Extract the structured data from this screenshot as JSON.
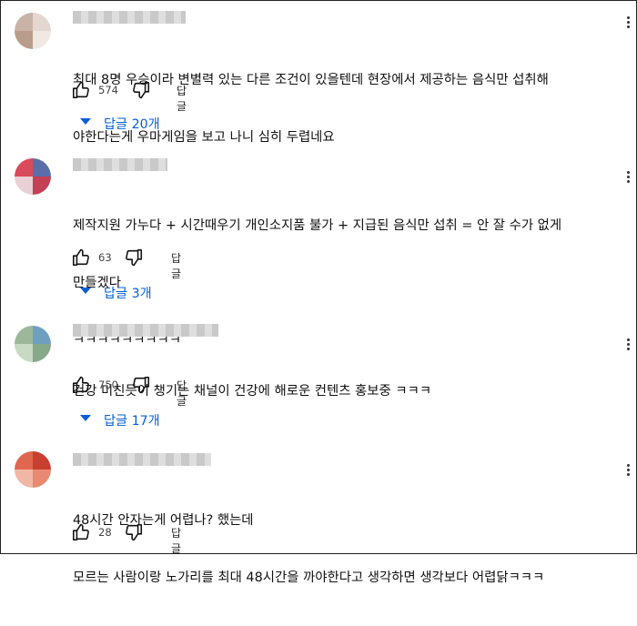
{
  "comments": [
    {
      "lines": [
        "최대 8명 우승이라 변별력 있는 다른 조건이 있을텐데 현장에서 제공하는 음식만 섭취해",
        "야한다는게 우마게임을 보고 나니 심히 두렵네요"
      ],
      "likes": "574",
      "reply_label": "답글",
      "replies": "답글 20개",
      "avatar_colors": [
        "#c9b3a6",
        "#e3d7cf",
        "#b99c8c",
        "#efe8e3"
      ]
    },
    {
      "lines": [
        "제작지원 가누다 + 시간때우기 개인소지품 불가 + 지급된 음식만 섭취 = 안 잘 수가 없게",
        "만들겠다",
        "ㅋㅋㅋㅋㅋㅋㅋㅋㅋ"
      ],
      "likes": "63",
      "reply_label": "답글",
      "replies": "답글 3개",
      "avatar_colors": [
        "#d94a5a",
        "#5a6fa8",
        "#e9d0d4",
        "#c44055"
      ]
    },
    {
      "lines": [
        "건강 미친듯이 챙기는 채널이 건강에 해로운 컨텐츠 홍보중 ㅋㅋㅋ"
      ],
      "likes": "750",
      "reply_label": "답글",
      "replies": "답글 17개",
      "avatar_colors": [
        "#9cb79a",
        "#6f9fbf",
        "#c8d9c4",
        "#88a88a"
      ]
    },
    {
      "lines": [
        "48시간 안자는게 어렵나? 했는데",
        "모르는 사람이랑 노가리를 최대 48시간을 까야한다고 생각하면 생각보다 어렵닭ㅋㅋㅋ"
      ],
      "likes": "28",
      "reply_label": "답글",
      "avatar_colors": [
        "#e0674f",
        "#c93f2f",
        "#f1b7a6",
        "#e88a72"
      ]
    }
  ]
}
